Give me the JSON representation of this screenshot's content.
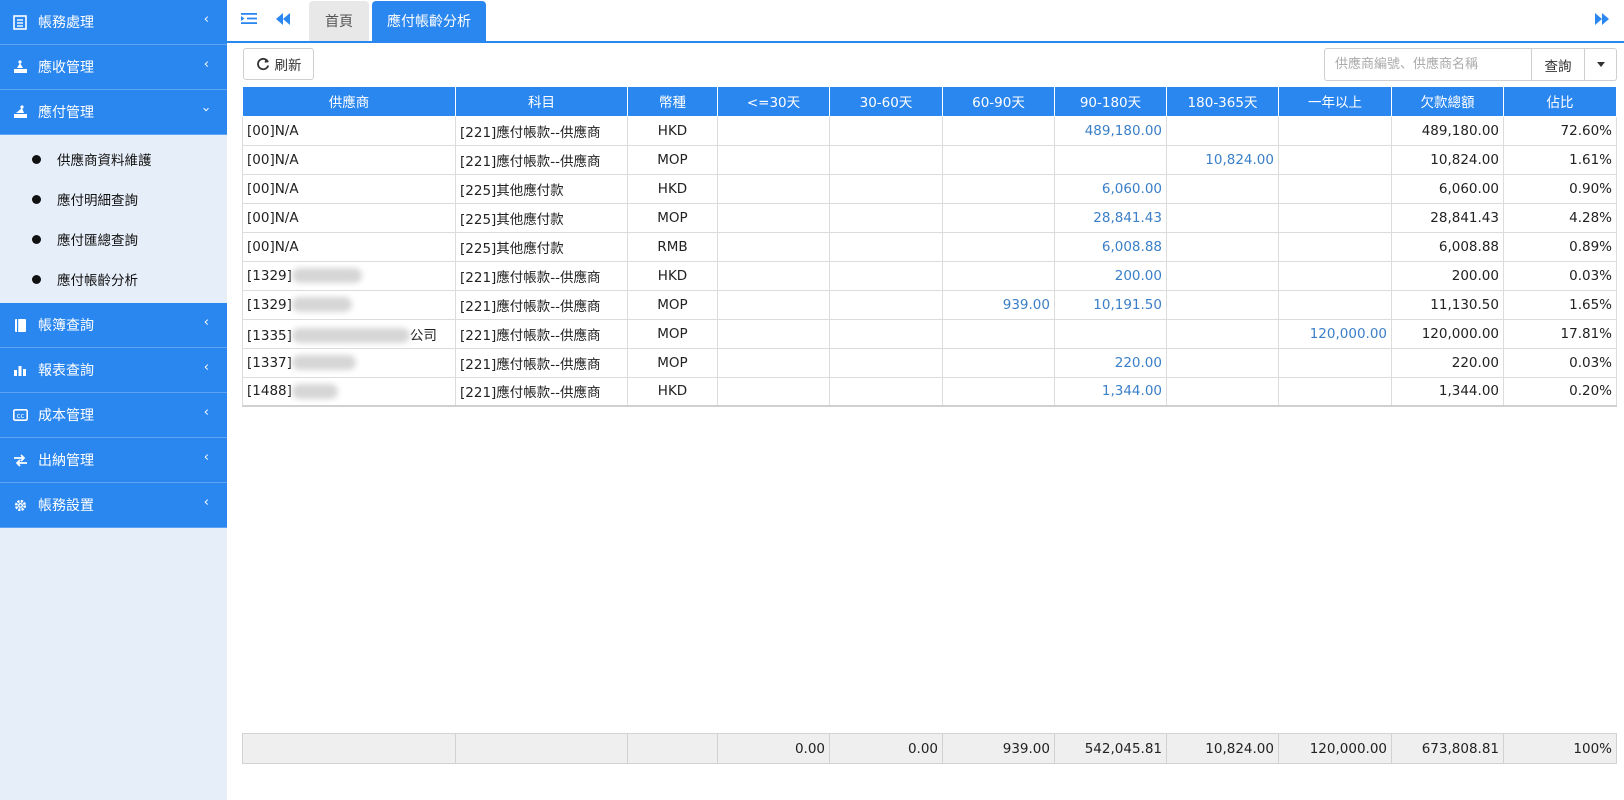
{
  "sidebar": {
    "menus": [
      {
        "label": "帳務處理",
        "icon": "ledger-icon"
      },
      {
        "label": "應收管理",
        "icon": "receivable-icon"
      },
      {
        "label": "應付管理",
        "icon": "payable-icon",
        "expanded": true
      },
      {
        "label": "帳簿查詢",
        "icon": "book-icon"
      },
      {
        "label": "報表查詢",
        "icon": "bar-chart-icon"
      },
      {
        "label": "成本管理",
        "icon": "cost-card-icon"
      },
      {
        "label": "出納管理",
        "icon": "exchange-arrows-icon"
      },
      {
        "label": "帳務設置",
        "icon": "gear-icon"
      }
    ],
    "submenu": [
      {
        "label": "供應商資料維護"
      },
      {
        "label": "應付明細查詢"
      },
      {
        "label": "應付匯總查詢"
      },
      {
        "label": "應付帳齡分析"
      }
    ]
  },
  "tabs": {
    "home": "首頁",
    "active": "應付帳齡分析"
  },
  "toolbar": {
    "refresh_label": "刷新",
    "search_placeholder": "供應商編號、供應商名稱",
    "search_label": "查詢"
  },
  "table": {
    "headers": [
      "供應商",
      "科目",
      "幣種",
      "<=30天",
      "30-60天",
      "60-90天",
      "90-180天",
      "180-365天",
      "一年以上",
      "欠款總額",
      "佔比"
    ],
    "rows": [
      {
        "supplier": "[00]N/A",
        "account": "[221]應付帳款--供應商",
        "currency": "HKD",
        "d30": "",
        "d60": "",
        "d90": "",
        "d180": "489,180.00",
        "d365": "",
        "over1y": "",
        "total": "489,180.00",
        "ratio": "72.60%"
      },
      {
        "supplier": "[00]N/A",
        "account": "[221]應付帳款--供應商",
        "currency": "MOP",
        "d30": "",
        "d60": "",
        "d90": "",
        "d180": "",
        "d365": "10,824.00",
        "over1y": "",
        "total": "10,824.00",
        "ratio": "1.61%"
      },
      {
        "supplier": "[00]N/A",
        "account": "[225]其他應付款",
        "currency": "HKD",
        "d30": "",
        "d60": "",
        "d90": "",
        "d180": "6,060.00",
        "d365": "",
        "over1y": "",
        "total": "6,060.00",
        "ratio": "0.90%"
      },
      {
        "supplier": "[00]N/A",
        "account": "[225]其他應付款",
        "currency": "MOP",
        "d30": "",
        "d60": "",
        "d90": "",
        "d180": "28,841.43",
        "d365": "",
        "over1y": "",
        "total": "28,841.43",
        "ratio": "4.28%"
      },
      {
        "supplier": "[00]N/A",
        "account": "[225]其他應付款",
        "currency": "RMB",
        "d30": "",
        "d60": "",
        "d90": "",
        "d180": "6,008.88",
        "d365": "",
        "over1y": "",
        "total": "6,008.88",
        "ratio": "0.89%"
      },
      {
        "supplier": "[1329]",
        "account": "[221]應付帳款--供應商",
        "currency": "HKD",
        "d30": "",
        "d60": "",
        "d90": "",
        "d180": "200.00",
        "d365": "",
        "over1y": "",
        "total": "200.00",
        "ratio": "0.03%"
      },
      {
        "supplier": "[1329]",
        "account": "[221]應付帳款--供應商",
        "currency": "MOP",
        "d30": "",
        "d60": "",
        "d90": "939.00",
        "d180": "10,191.50",
        "d365": "",
        "over1y": "",
        "total": "11,130.50",
        "ratio": "1.65%"
      },
      {
        "supplier": "[1335]",
        "supplier_suffix": "公司",
        "account": "[221]應付帳款--供應商",
        "currency": "MOP",
        "d30": "",
        "d60": "",
        "d90": "",
        "d180": "",
        "d365": "",
        "over1y": "120,000.00",
        "total": "120,000.00",
        "ratio": "17.81%"
      },
      {
        "supplier": "[1337]",
        "account": "[221]應付帳款--供應商",
        "currency": "MOP",
        "d30": "",
        "d60": "",
        "d90": "",
        "d180": "220.00",
        "d365": "",
        "over1y": "",
        "total": "220.00",
        "ratio": "0.03%"
      },
      {
        "supplier": "[1488]",
        "account": "[221]應付帳款--供應商",
        "currency": "HKD",
        "d30": "",
        "d60": "",
        "d90": "",
        "d180": "1,344.00",
        "d365": "",
        "over1y": "",
        "total": "1,344.00",
        "ratio": "0.20%"
      }
    ],
    "totals": {
      "d30": "0.00",
      "d60": "0.00",
      "d90": "939.00",
      "d180": "542,045.81",
      "d365": "10,824.00",
      "over1y": "120,000.00",
      "total": "673,808.81",
      "ratio": "100%"
    }
  },
  "colors": {
    "accent": "#2b87f0",
    "link": "#3a7fc8",
    "sidebar_bg": "#e6eef9"
  }
}
